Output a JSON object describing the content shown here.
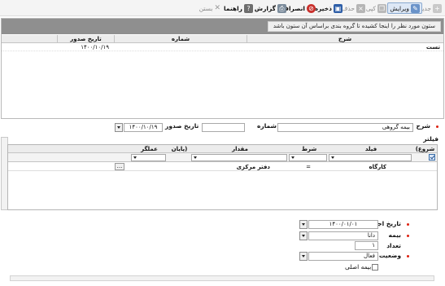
{
  "toolbar": {
    "new": "جدید",
    "edit": "ویرایش",
    "copy": "کپی",
    "delete": "حذف",
    "save": "ذخیره",
    "cancel": "انصراف",
    "report": "گزارش",
    "help": "راهنما",
    "close": "بستن"
  },
  "grid": {
    "group_hint": "ستون مورد نظر را اینجا کشیده تا گروه بندی براساس آن ستون باشد",
    "columns": [
      "شرح",
      "شماره",
      "تاریخ صدور"
    ],
    "rows": [
      {
        "description": "تست",
        "number": "",
        "date": "۱۴۰۰/۱۰/۱۹"
      }
    ]
  },
  "form": {
    "description_label": "شرح",
    "description_value": "بیمه گروهی",
    "number_label": "شماره",
    "number_value": "",
    "issue_date_label": "تاریخ صدور",
    "issue_date_value": "۱۴۰۰/۱۰/۱۹",
    "filter_label": "فیلتر",
    "exec_date_label": "تاریخ اجرا",
    "exec_date_value": "۱۴۰۰/۰۱/۰۱",
    "insurance_label": "بیمه",
    "insurance_value": "دانا",
    "count_label": "تعداد",
    "count_value": "۱",
    "status_label": "وضعیت بیمه",
    "status_value": "فعال",
    "main_insurance_label": "بیمه اصلی"
  },
  "filter_grid": {
    "columns": [
      "(شروع",
      "فیلد",
      "شرط",
      "مقدار",
      "پایان)",
      "عملگر"
    ],
    "rows": [
      {
        "start": "",
        "field": "کارگاه",
        "condition": "=",
        "value": "دفتر مرکزی",
        "end": "",
        "operator": ""
      }
    ],
    "ellipsis": "..."
  },
  "colors": {
    "required": "#d21",
    "group_bar": "#8f8f8f",
    "header_bg": "#ececec"
  }
}
